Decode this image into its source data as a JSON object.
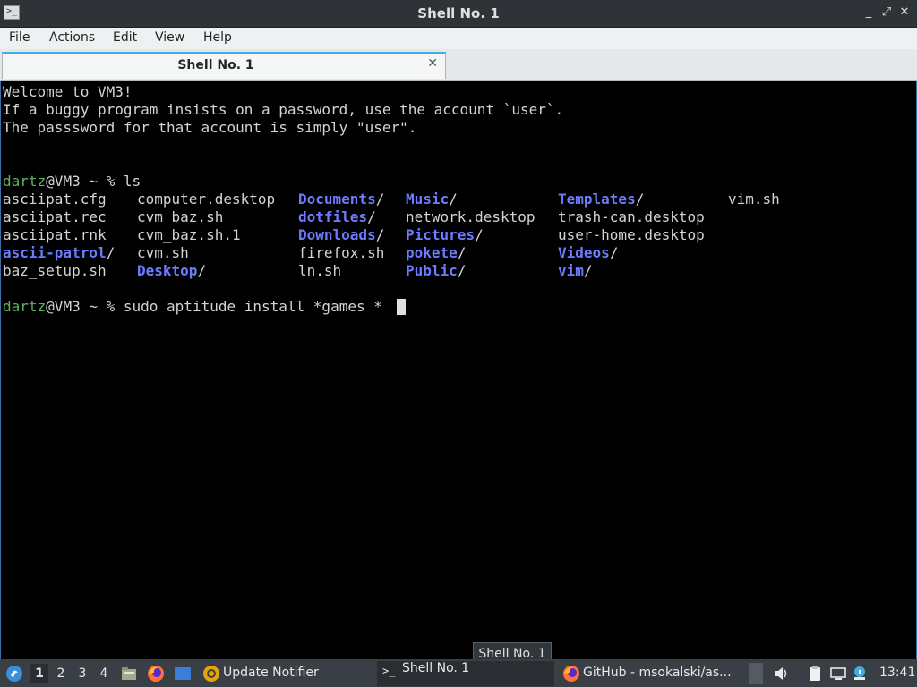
{
  "window": {
    "title": "Shell No. 1",
    "min": "_",
    "max": "⤢",
    "close": "✕"
  },
  "menu": [
    "File",
    "Actions",
    "Edit",
    "View",
    "Help"
  ],
  "tab": {
    "label": "Shell No. 1",
    "close": "✕"
  },
  "terminal": {
    "welcome": [
      "Welcome to VM3!",
      "If a buggy program insists on a password, use the account `user`.",
      "The passsword for that account is simply \"user\"."
    ],
    "prompt_user": "dartz",
    "prompt_rest": "@VM3 ~ % ",
    "cmd1": "ls",
    "cmd2": "sudo aptitude install *games *",
    "ls": [
      [
        "asciipat.cfg",
        "asciipat.rec",
        "asciipat.rnk",
        "ascii-patrol",
        "baz_setup.sh"
      ],
      [
        "computer.desktop",
        "cvm_baz.sh",
        "cvm_baz.sh.1",
        "cvm.sh",
        "Desktop"
      ],
      [
        "Documents",
        "dotfiles",
        "Downloads",
        "firefox.sh",
        "ln.sh"
      ],
      [
        "Music",
        "network.desktop",
        "Pictures",
        "pokete",
        "Public"
      ],
      [
        "Templates",
        "trash-can.desktop",
        "user-home.desktop",
        "Videos",
        "vim"
      ],
      [
        "vim.sh"
      ]
    ],
    "slash": "/"
  },
  "tooltip": "Shell No. 1",
  "taskbar": {
    "workspaces": [
      "1",
      "2",
      "3",
      "4"
    ],
    "tasks": {
      "notifier": "Update Notifier",
      "shell": "Shell No. 1",
      "github": "GitHub - msokalski/as..."
    },
    "clock": "13:41"
  },
  "colors": {
    "dir": "#6d7cff",
    "user": "#5fb35f",
    "accent": "#3daee9"
  },
  "icons": [
    "terminal-icon",
    "start-menu-icon",
    "file-manager-icon",
    "firefox-icon",
    "desktop-icon",
    "update-notifier-icon",
    "clipboard-icon",
    "volume-icon",
    "network-icon",
    "info-icon"
  ]
}
